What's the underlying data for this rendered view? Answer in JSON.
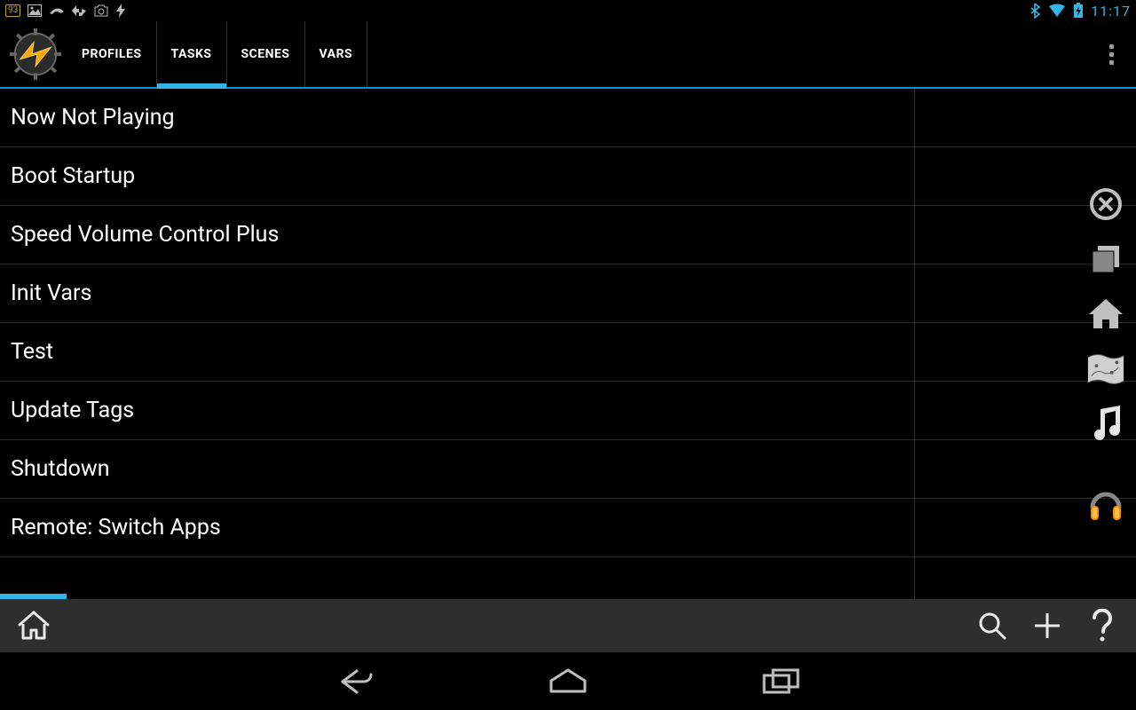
{
  "status_bar": {
    "battery_percent": "93",
    "clock": "11:17"
  },
  "tabs": [
    {
      "id": "profiles",
      "label": "PROFILES",
      "active": false
    },
    {
      "id": "tasks",
      "label": "TASKS",
      "active": true
    },
    {
      "id": "scenes",
      "label": "SCENES",
      "active": false
    },
    {
      "id": "vars",
      "label": "VARS",
      "active": false
    }
  ],
  "tasks": [
    "Now Not Playing",
    "Boot Startup",
    "Speed Volume Control Plus",
    "Init Vars",
    "Test",
    "Update Tags",
    "Shutdown",
    "Remote: Switch Apps"
  ],
  "side_icons": [
    "cancel-icon",
    "windows-icon",
    "home-icon",
    "map-icon",
    "music-icon",
    "headphones-icon"
  ],
  "bottom_buttons": [
    "search-icon",
    "plus-icon",
    "help-icon"
  ],
  "colors": {
    "holo_blue": "#33b5e5",
    "holo_blue_dark": "#0099cc"
  }
}
